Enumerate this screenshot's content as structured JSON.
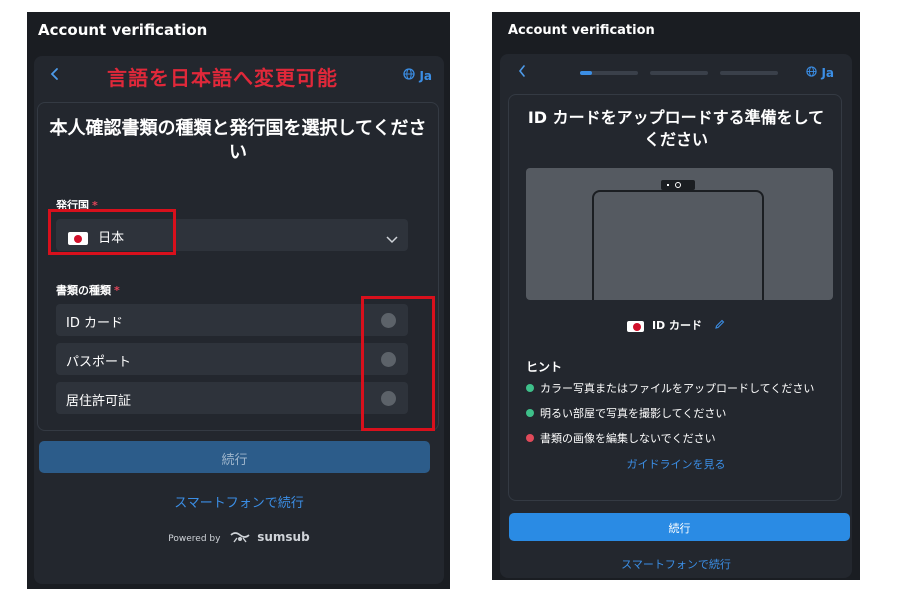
{
  "left": {
    "window_title": "Account verification",
    "annotation_text": "言語を日本語へ変更可能",
    "language_code": "Ja",
    "heading": "本人確認書類の種類と発行国を選択してください",
    "country_label": "発行国",
    "required_mark": "*",
    "country_value": "日本",
    "doc_type_label": "書類の種類",
    "doc_types": [
      "ID カード",
      "パスポート",
      "居住許可証"
    ],
    "continue_label": "続行",
    "phone_link": "スマートフォンで続行",
    "powered_by": "Powered by",
    "brand": "sumsub"
  },
  "right": {
    "window_title": "Account verification",
    "language_code": "Ja",
    "heading": "ID カードをアップロードする準備をしてください",
    "doc_tag": "ID カード",
    "hints_title": "ヒント",
    "hints": [
      {
        "text": "カラー写真またはファイルをアップロードしてください",
        "status": "ok"
      },
      {
        "text": "明るい部屋で写真を撮影してください",
        "status": "ok"
      },
      {
        "text": "書類の画像を編集しないでください",
        "status": "error"
      }
    ],
    "guide_link": "ガイドラインを見る",
    "continue_label": "続行",
    "phone_link": "スマートフォンで続行",
    "step_progress": 0.33
  },
  "colors": {
    "accent_blue": "#3b8ee5",
    "annotation_red": "#d8101c",
    "ok_green": "#3ec08a",
    "error_red": "#e04a5a",
    "background_dark": "#1a1d22"
  },
  "icons": {
    "back": "chevron-left-icon",
    "language": "globe-icon",
    "dropdown": "chevron-down-icon",
    "edit": "pencil-icon",
    "brand_logo": "sumsub-logo-icon"
  }
}
